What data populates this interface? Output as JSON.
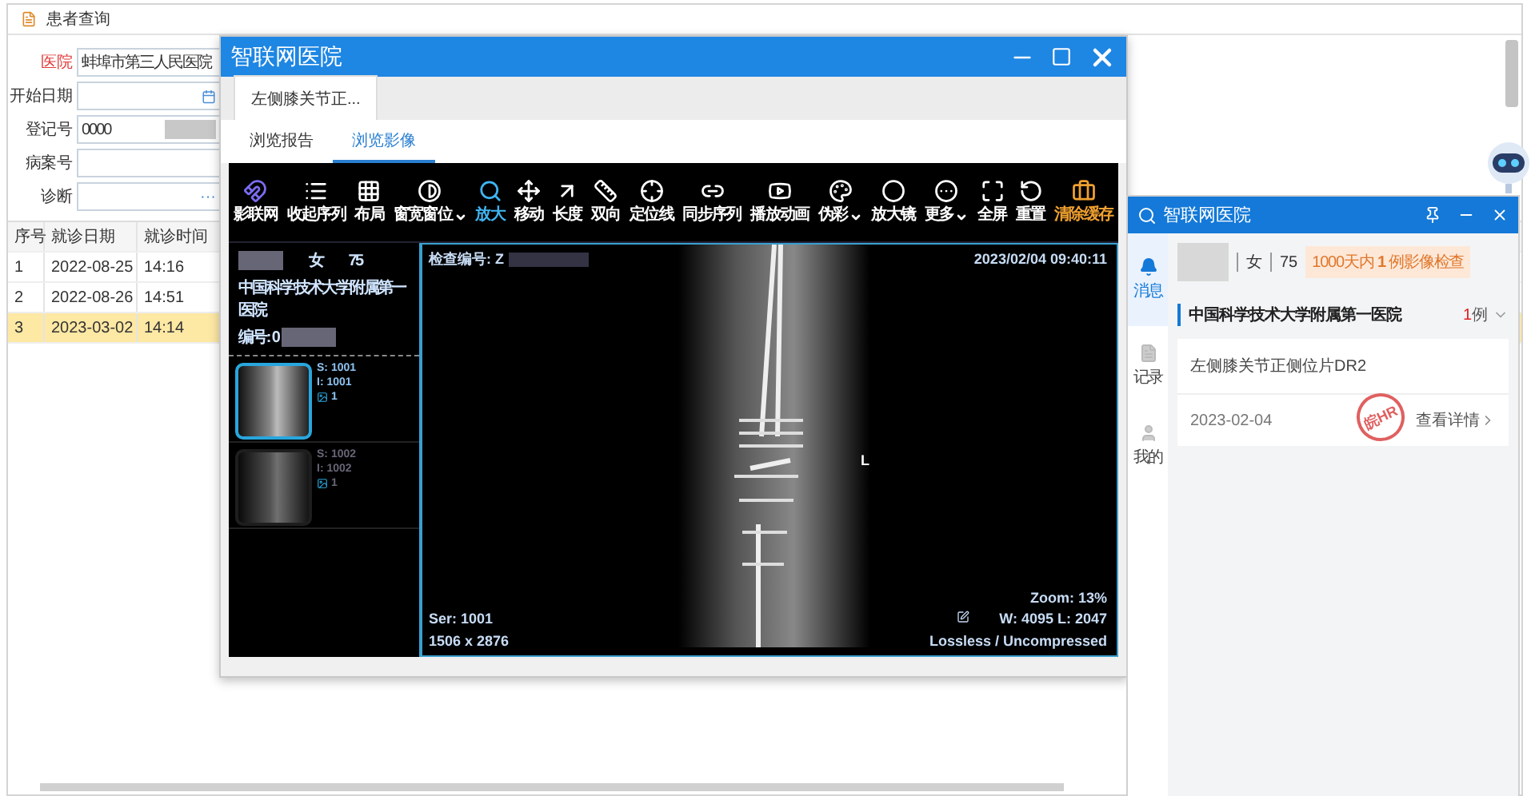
{
  "app": {
    "title": "患者查询",
    "form": [
      {
        "label": "医院",
        "required": true,
        "value": "蚌埠市第三人民医院",
        "kind": "text"
      },
      {
        "label": "开始日期",
        "required": false,
        "kind": "date"
      },
      {
        "label": "登记号",
        "required": false,
        "value": "0000",
        "kind": "masked"
      },
      {
        "label": "病案号",
        "required": false,
        "kind": "text"
      },
      {
        "label": "诊断",
        "required": false,
        "kind": "more"
      }
    ],
    "more_button": "···",
    "table": {
      "columns": [
        "序号",
        "就诊日期",
        "就诊时间"
      ],
      "rows": [
        {
          "cells": [
            "1",
            "2022-08-25",
            "14:16"
          ],
          "selected": false
        },
        {
          "cells": [
            "2",
            "2022-08-26",
            "14:51"
          ],
          "selected": false
        },
        {
          "cells": [
            "3",
            "2023-03-02",
            "14:14"
          ],
          "selected": true
        }
      ]
    }
  },
  "viewer": {
    "title": "智联网医院",
    "doc_tab": "左侧膝关节正...",
    "tabs": [
      {
        "label": "浏览报告",
        "selected": false
      },
      {
        "label": "浏览影像",
        "selected": true
      }
    ],
    "tools": [
      {
        "label": "影联网",
        "kind": "logo",
        "selected": false,
        "dropdown": false
      },
      {
        "label": "收起序列",
        "kind": "tool",
        "selected": false,
        "dropdown": false
      },
      {
        "label": "布局",
        "kind": "tool",
        "selected": false,
        "dropdown": false
      },
      {
        "label": "窗宽窗位",
        "kind": "tool",
        "selected": false,
        "dropdown": true
      },
      {
        "label": "放大",
        "kind": "tool",
        "selected": true,
        "dropdown": false
      },
      {
        "label": "移动",
        "kind": "tool",
        "selected": false,
        "dropdown": false
      },
      {
        "label": "长度",
        "kind": "tool",
        "selected": false,
        "dropdown": false
      },
      {
        "label": "双向",
        "kind": "tool",
        "selected": false,
        "dropdown": false
      },
      {
        "label": "定位线",
        "kind": "tool",
        "selected": false,
        "dropdown": false
      },
      {
        "label": "同步序列",
        "kind": "tool",
        "selected": false,
        "dropdown": false
      },
      {
        "label": "播放动画",
        "kind": "tool",
        "selected": false,
        "dropdown": false
      },
      {
        "label": "伪彩",
        "kind": "tool",
        "selected": false,
        "dropdown": true
      },
      {
        "label": "放大镜",
        "kind": "tool",
        "selected": false,
        "dropdown": false
      },
      {
        "label": "更多",
        "kind": "tool",
        "selected": false,
        "dropdown": true
      },
      {
        "label": "全屏",
        "kind": "tool",
        "selected": false,
        "dropdown": false
      },
      {
        "label": "重置",
        "kind": "tool",
        "selected": false,
        "dropdown": false
      },
      {
        "label": "清除缓存",
        "kind": "warning",
        "selected": false,
        "dropdown": false
      }
    ],
    "patient": {
      "sex": "女",
      "age": "75",
      "hospital": "中国科学技术大学附属第一医院",
      "id_label": "编号:",
      "id_value": "0"
    },
    "series": [
      {
        "s": "S: 1001",
        "i": "I: 1001",
        "count": "1",
        "selected": true
      },
      {
        "s": "S: 1002",
        "i": "I: 1002",
        "count": "1",
        "selected": false
      }
    ],
    "overlay": {
      "exam_no": "检查编号: Z",
      "datetime": "2023/02/04 09:40:11",
      "marker": "L",
      "ser": "Ser: 1001",
      "size": "1506 x 2876",
      "zoom": "Zoom: 13%",
      "wl": "W: 4095 L: 2047",
      "compression": "Lossless / Uncompressed"
    }
  },
  "sidebar": {
    "title": "智联网医院",
    "rail": [
      {
        "label": "消息",
        "selected": true
      },
      {
        "label": "记录",
        "selected": false
      },
      {
        "label": "我的",
        "selected": false
      }
    ],
    "patient": {
      "sex": "女",
      "age": "75",
      "badge": "1000天内 **1** 例影像检查"
    },
    "group": {
      "hospital": "中国科学技术大学附属第一医院",
      "count": "1",
      "unit": "例"
    },
    "record": {
      "title": "左侧膝关节正侧位片DR2",
      "stamp": "皖HR",
      "date": "2023-02-04",
      "link": "查看详情"
    }
  }
}
